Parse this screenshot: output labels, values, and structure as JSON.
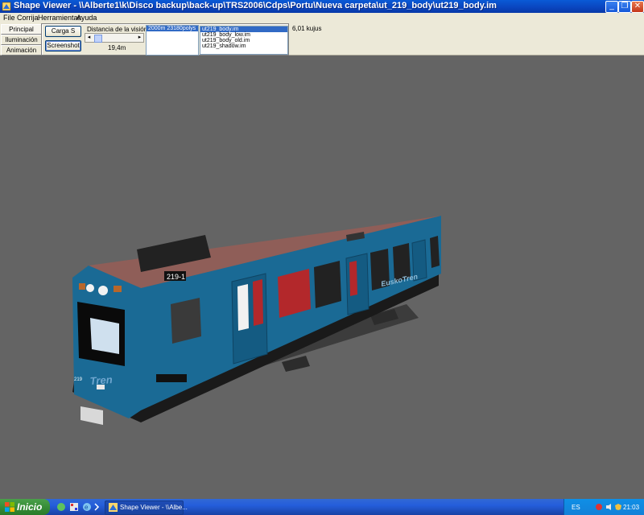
{
  "window": {
    "title": "Shape Viewer - \\\\Alberte1\\k\\Disco backup\\back-up\\TRS2006\\Cdps\\Portu\\Nueva carpeta\\ut_219_body\\ut219_body.im",
    "minimize": "_",
    "maximize": "❐",
    "close": "✕"
  },
  "menu": {
    "items": [
      "File",
      "Corrija",
      "Herramientas",
      "Ayuda"
    ]
  },
  "sidebar": {
    "tabs": [
      "Principal",
      "Iluminación",
      "Animación"
    ],
    "active": "Principal"
  },
  "controls": {
    "load_button": "Carga S",
    "screenshot_button": "Screenshot",
    "distance_label": "Distancia de la visión",
    "distance_value": "19,4m",
    "scroll_left": "◂",
    "scroll_right": "▸"
  },
  "lod_list": {
    "items": [
      "2000m 23180polys"
    ],
    "selected": 0
  },
  "file_list": {
    "items": [
      "ut219_body.im",
      "ut219_body_low.im",
      "ut219_body_old.im",
      "ut219_shadow.im"
    ],
    "selected": 0
  },
  "size_text": "6,01 kujus",
  "model": {
    "unit_number": "219-1",
    "brand": "EuskoTren",
    "brand_logo": "Tren",
    "small_number": "219",
    "body_color": "#1a6a95",
    "roof_color": "#8f5e58"
  },
  "taskbar": {
    "start_label": "Inicio",
    "task_label": "Shape Viewer - \\\\Albe...",
    "language": "ES",
    "clock": "21:03"
  },
  "colors": {
    "titlebar": "#0a46c0",
    "taskbar": "#245edb",
    "start": "#378d37",
    "viewport": "#646464"
  }
}
